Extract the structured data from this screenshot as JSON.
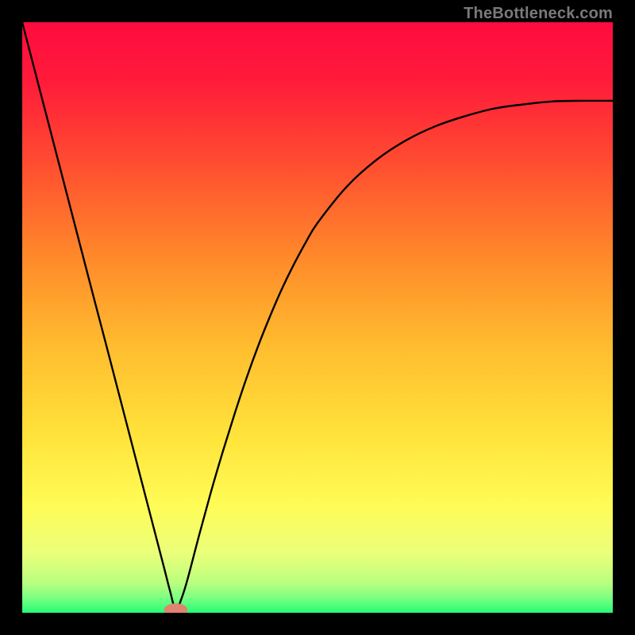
{
  "watermark": "TheBottleneck.com",
  "chart_data": {
    "type": "line",
    "title": "",
    "xlabel": "",
    "ylabel": "",
    "xlim": [
      0,
      100
    ],
    "ylim": [
      0,
      100
    ],
    "grid": false,
    "legend": false,
    "notch": {
      "x": 26,
      "half_width": 4
    },
    "curve": {
      "x": [
        0,
        2,
        4,
        6,
        8,
        10,
        12,
        14,
        16,
        18,
        20,
        22,
        24,
        25,
        26,
        27,
        28,
        30,
        32,
        34,
        36,
        38,
        40,
        42,
        44,
        46,
        48,
        50,
        55,
        60,
        65,
        70,
        75,
        80,
        85,
        90,
        95,
        100
      ],
      "y": [
        100,
        92.3,
        84.6,
        76.9,
        69.2,
        61.5,
        53.8,
        46.2,
        38.5,
        30.8,
        23.1,
        15.4,
        7.7,
        3.8,
        0.5,
        2.5,
        5.7,
        13.3,
        20.6,
        27.4,
        33.8,
        39.8,
        45.3,
        50.3,
        54.9,
        59.0,
        62.7,
        66.0,
        72.2,
        76.7,
        80.0,
        82.4,
        84.1,
        85.4,
        86.1,
        86.6,
        86.7,
        86.7
      ]
    },
    "gradient_stops": [
      {
        "pos": 0.0,
        "color": "#ff0b3f"
      },
      {
        "pos": 0.1,
        "color": "#ff1b3a"
      },
      {
        "pos": 0.25,
        "color": "#ff5130"
      },
      {
        "pos": 0.4,
        "color": "#ff8a2a"
      },
      {
        "pos": 0.55,
        "color": "#ffbd2f"
      },
      {
        "pos": 0.7,
        "color": "#ffe33a"
      },
      {
        "pos": 0.82,
        "color": "#fffc57"
      },
      {
        "pos": 0.9,
        "color": "#eaff7a"
      },
      {
        "pos": 0.95,
        "color": "#b9ff7f"
      },
      {
        "pos": 0.975,
        "color": "#7aff82"
      },
      {
        "pos": 1.0,
        "color": "#26fc76"
      }
    ],
    "marker": {
      "cx": 26,
      "cy": 0.5,
      "rx": 2.0,
      "ry": 1.1,
      "color": "#e0836f"
    }
  }
}
